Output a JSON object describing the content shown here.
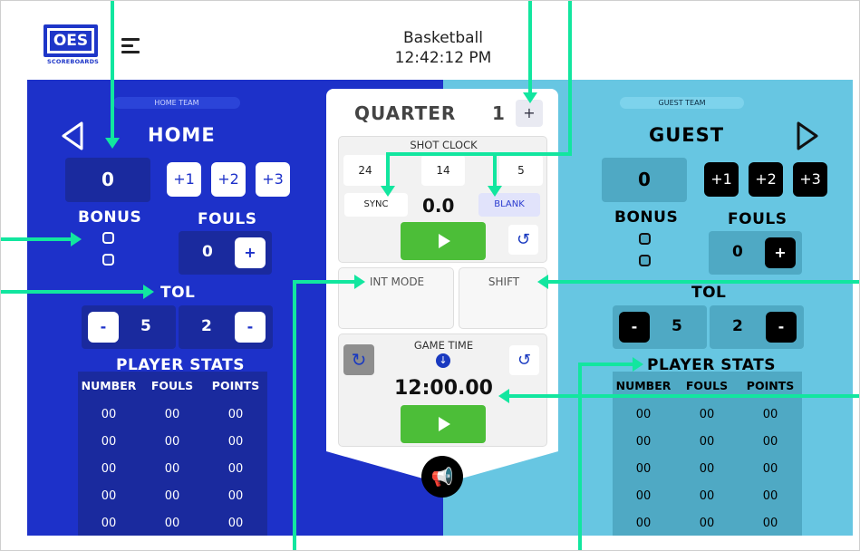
{
  "header": {
    "title": "Basketball",
    "time": "12:42:12 PM",
    "logo_text": "OES",
    "logo_sub": "SCOREBOARDS"
  },
  "home": {
    "tag": "HOME TEAM",
    "name": "HOME",
    "score": "0",
    "add_buttons": [
      "+1",
      "+2",
      "+3"
    ],
    "bonus_label": "BONUS",
    "fouls_label": "FOULS",
    "fouls": "0",
    "fouls_plus": "+",
    "tol_label": "TOL",
    "tol_minus1": "-",
    "tol_full": "5",
    "tol_partial": "2",
    "tol_minus2": "-",
    "stats_label": "PLAYER STATS",
    "stats_headers": [
      "NUMBER",
      "FOULS",
      "POINTS"
    ],
    "stats_rows": [
      [
        "00",
        "00",
        "00"
      ],
      [
        "00",
        "00",
        "00"
      ],
      [
        "00",
        "00",
        "00"
      ],
      [
        "00",
        "00",
        "00"
      ],
      [
        "00",
        "00",
        "00"
      ]
    ]
  },
  "guest": {
    "tag": "GUEST TEAM",
    "name": "GUEST",
    "score": "0",
    "add_buttons": [
      "+1",
      "+2",
      "+3"
    ],
    "bonus_label": "BONUS",
    "fouls_label": "FOULS",
    "fouls": "0",
    "fouls_plus": "+",
    "tol_label": "TOL",
    "tol_minus1": "-",
    "tol_full": "5",
    "tol_partial": "2",
    "tol_minus2": "-",
    "stats_label": "PLAYER STATS",
    "stats_headers": [
      "NUMBER",
      "FOULS",
      "POINTS"
    ],
    "stats_rows": [
      [
        "00",
        "00",
        "00"
      ],
      [
        "00",
        "00",
        "00"
      ],
      [
        "00",
        "00",
        "00"
      ],
      [
        "00",
        "00",
        "00"
      ],
      [
        "00",
        "00",
        "00"
      ]
    ]
  },
  "center": {
    "quarter_label": "QUARTER",
    "quarter": "1",
    "quarter_plus": "+",
    "shot_clock_label": "SHOT CLOCK",
    "shot_presets": [
      "24",
      "14",
      "5"
    ],
    "sync_label": "SYNC",
    "shot_value": "0.0",
    "blank_label": "BLANK",
    "int_mode_label": "INT MODE",
    "shift_label": "SHIFT",
    "game_time_label": "GAME TIME",
    "game_time": "12:00.00"
  },
  "colors": {
    "home_bg": "#1d31c9",
    "guest_bg": "#67c6e2",
    "accent_arrow": "#12e69f",
    "play_green": "#4cbe38"
  }
}
